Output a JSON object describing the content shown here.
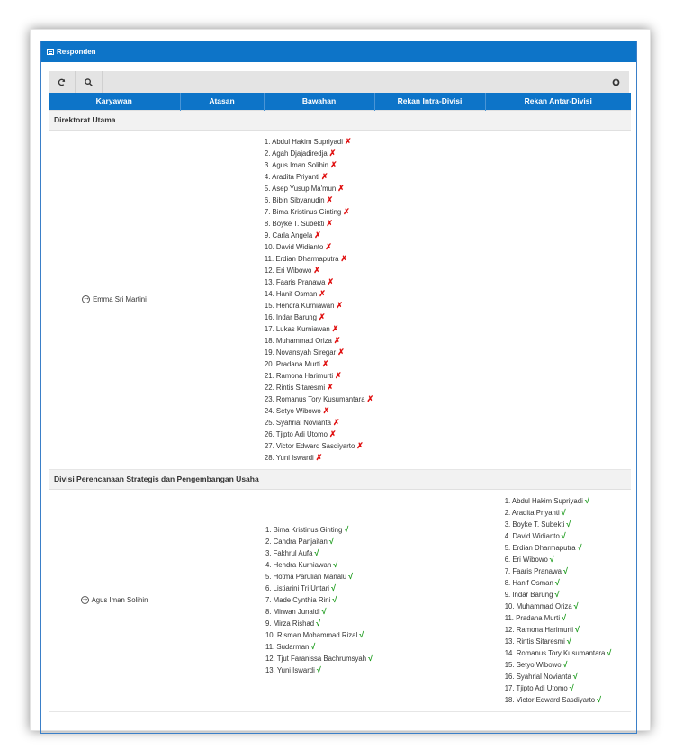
{
  "panel": {
    "title": "Responden"
  },
  "toolbar": {
    "refresh_icon": "refresh-icon",
    "search_icon": "search-icon",
    "right_icon": "power-icon"
  },
  "columns": [
    "Karyawan",
    "Atasan",
    "Bawahan",
    "Rekan Intra-Divisi",
    "Rekan Antar-Divisi"
  ],
  "groups": [
    {
      "name": "Direktorat Utama",
      "employee": "Emma Sri Martini",
      "bawahan": [
        "1. Abdul Hakim Supriyadi",
        "2. Agah Djajadiredja",
        "3. Agus Iman Solihin",
        "4. Aradita Priyanti",
        "5. Asep Yusup Ma'mun",
        "6. Bibin Sibyanudin",
        "7. Bima Kristinus Ginting",
        "8. Boyke T. Subekti",
        "9. Carla Angela",
        "10. David Widianto",
        "11. Erdian Dharmaputra",
        "12. Eri Wibowo",
        "13. Faaris Pranawa",
        "14. Hanif Osman",
        "15. Hendra Kurniawan",
        "16. Indar Barung",
        "17. Lukas Kurniawan",
        "18. Muhammad Oriza",
        "19. Novansyah Siregar",
        "20. Pradana Murti",
        "21. Ramona Harimurti",
        "22. Rintis Sitaresmi",
        "23. Romanus Tory Kusumantara",
        "24. Setyo Wibowo",
        "25. Syahrial Novianta",
        "26. Tjipto Adi Utomo",
        "27. Victor Edward Sasdiyarto",
        "28. Yuni Iswardi"
      ],
      "bawahan_mark": "✗",
      "antar": [],
      "antar_mark": ""
    },
    {
      "name": "Divisi Perencanaan Strategis dan Pengembangan Usaha",
      "employee": "Agus Iman Solihin",
      "bawahan": [
        "1. Bima Kristinus Ginting",
        "2. Candra Panjaitan",
        "3. Fakhrul Aufa",
        "4. Hendra Kurniawan",
        "5. Hotma Parulian Manalu",
        "6. Listiarini Tri Untari",
        "7. Made Cynthia Rini",
        "8. Mirwan Junaidi",
        "9. Mirza Rishad",
        "10. Risman Mohammad Rizal",
        "11. Sudarman",
        "12. Tjut Faranissa Bachrumsyah",
        "13. Yuni Iswardi"
      ],
      "bawahan_mark": "√",
      "antar": [
        "1. Abdul Hakim Supriyadi",
        "2. Aradita Priyanti",
        "3. Boyke T. Subekti",
        "4. David Widianto",
        "5. Erdian Dharmaputra",
        "6. Eri Wibowo",
        "7. Faaris Pranawa",
        "8. Hanif Osman",
        "9. Indar Barung",
        "10. Muhammad Oriza",
        "11. Pradana Murti",
        "12. Ramona Harimurti",
        "13. Rintis Sitaresmi",
        "14. Romanus Tory Kusumantara",
        "15. Setyo Wibowo",
        "16. Syahrial Novianta",
        "17. Tjipto Adi Utomo",
        "18. Victor Edward Sasdiyarto"
      ],
      "antar_mark": "√"
    }
  ]
}
